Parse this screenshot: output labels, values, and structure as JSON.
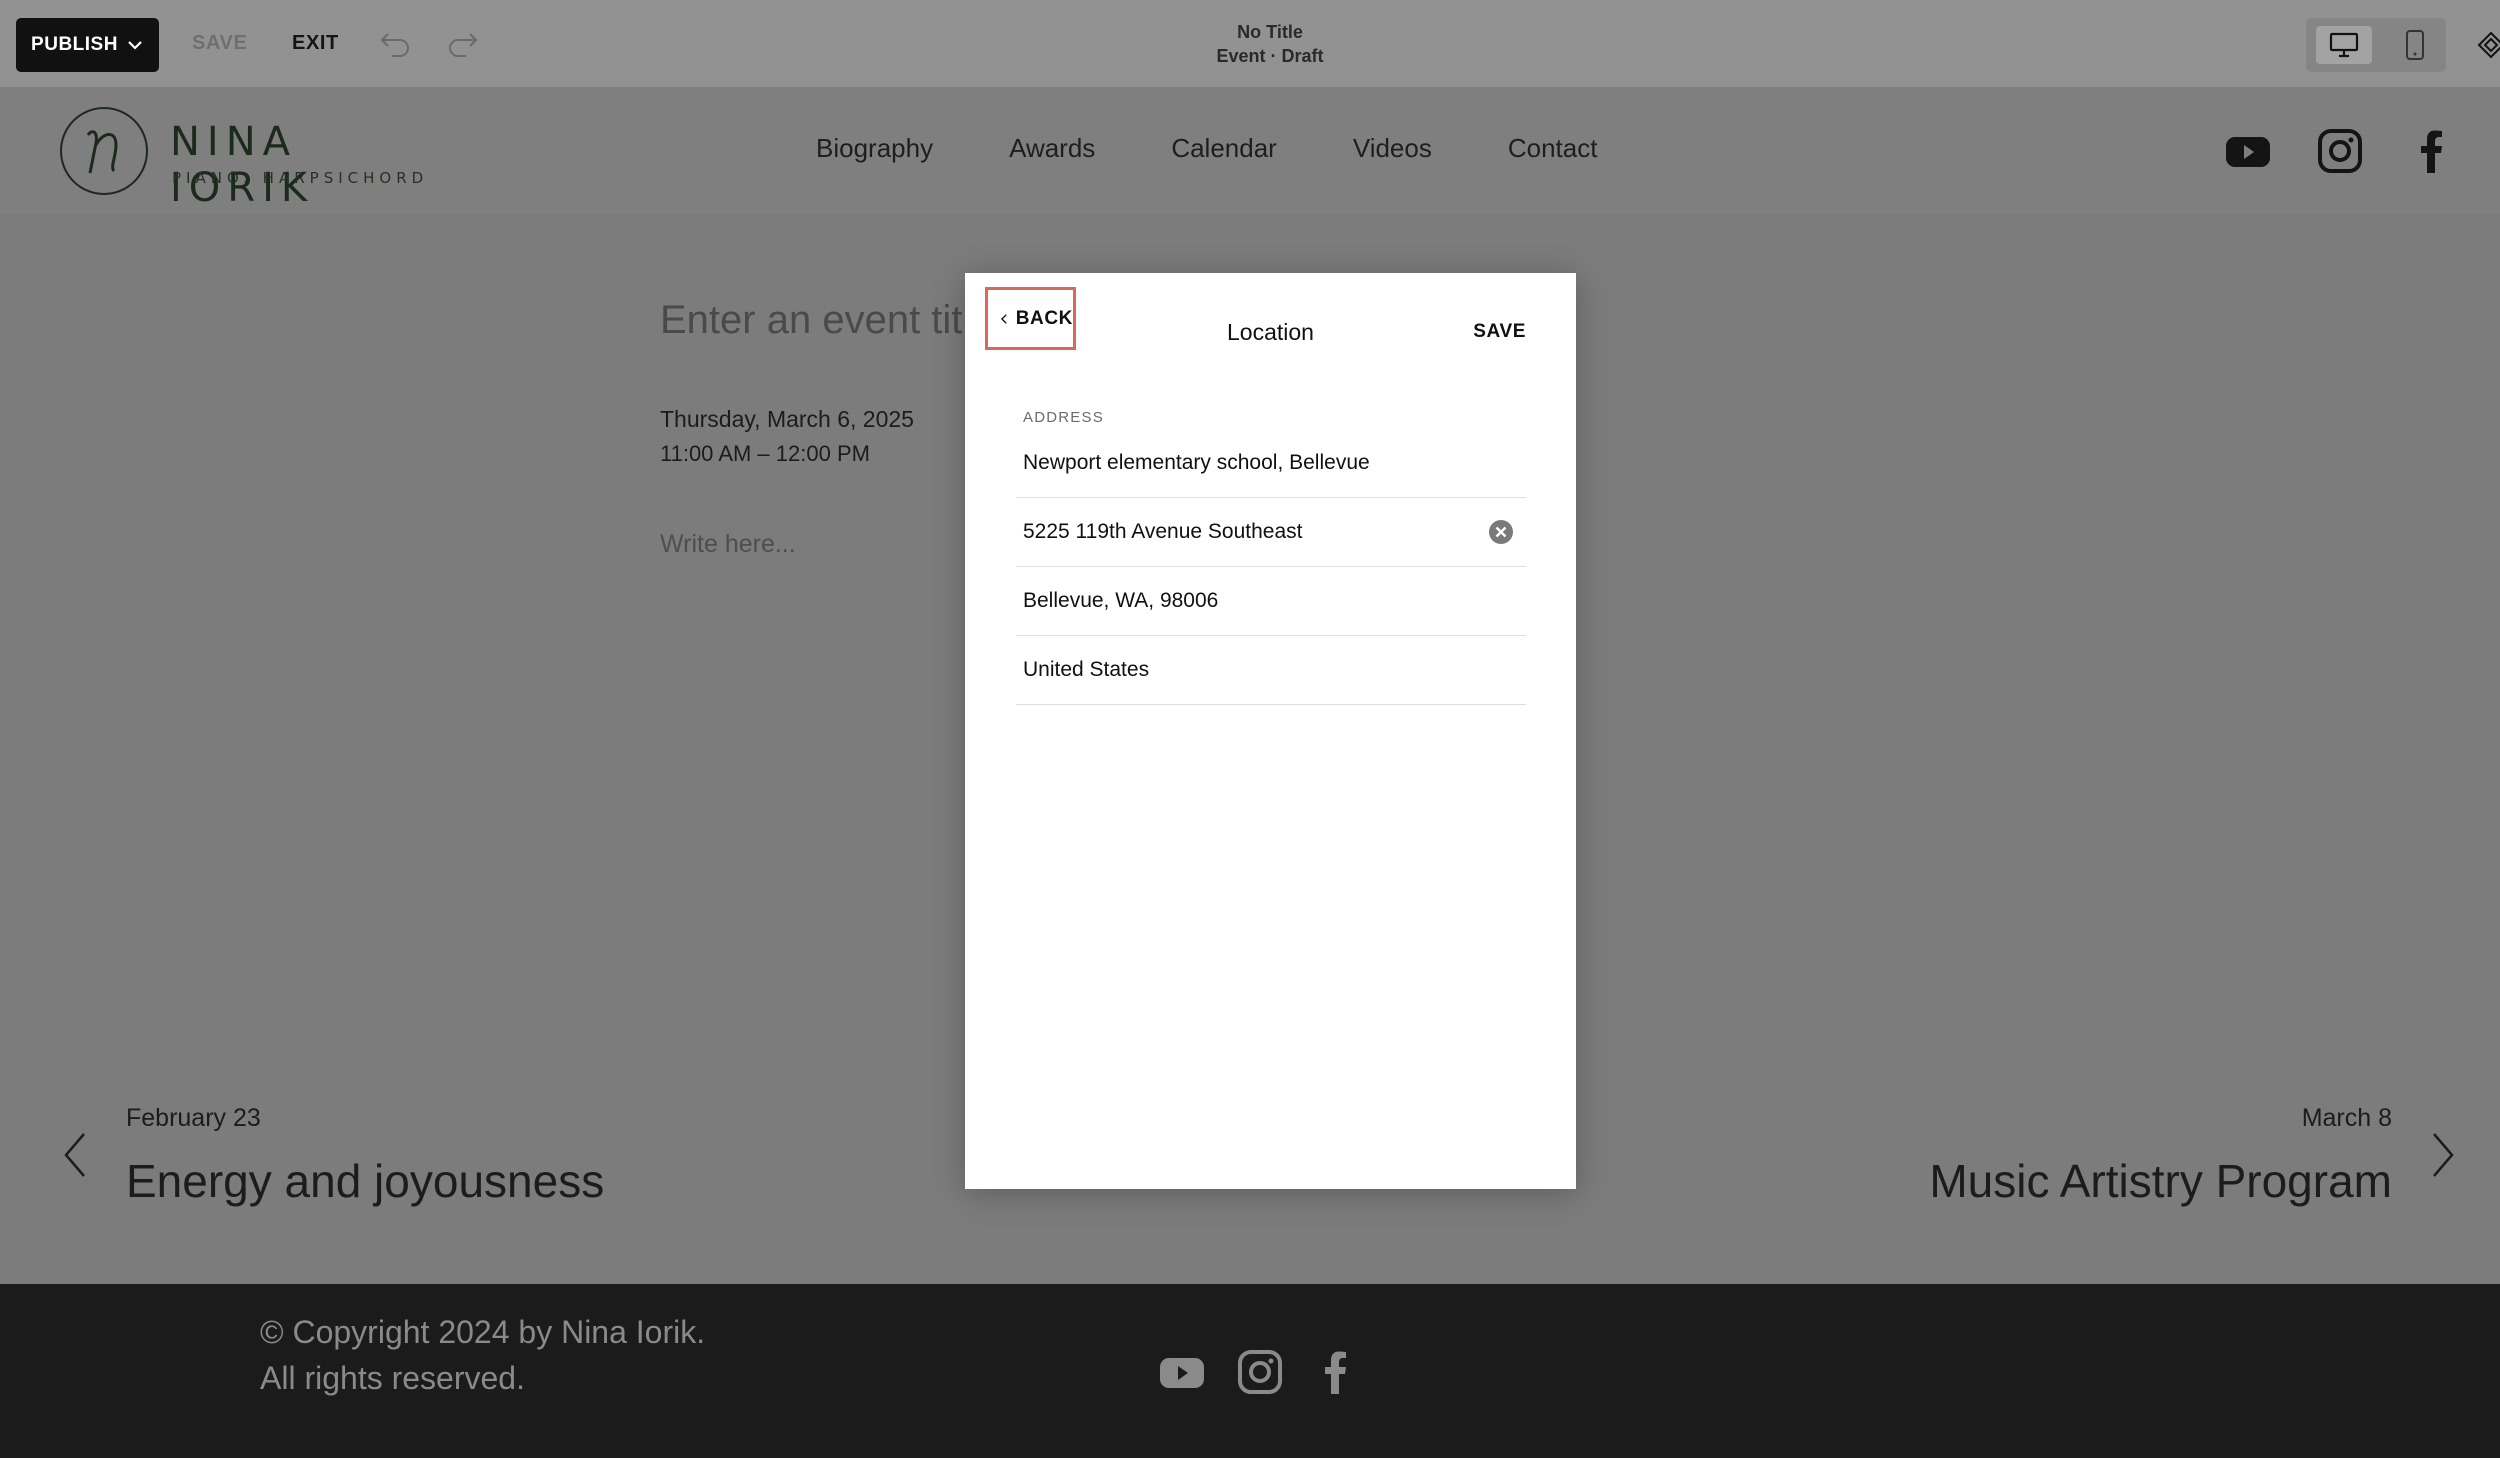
{
  "toolbar": {
    "publish_label": "PUBLISH",
    "save_label": "SAVE",
    "exit_label": "EXIT",
    "doc_title": "No Title",
    "doc_status": "Event · Draft",
    "icons": [
      "chevron-down-icon",
      "undo-icon",
      "redo-icon",
      "desktop-icon",
      "mobile-icon"
    ]
  },
  "site": {
    "logo_name": "NINA IORIK",
    "logo_subtitle": "PIANO. HARPSICHORD",
    "nav": [
      "Biography",
      "Awards",
      "Calendar",
      "Videos",
      "Contact"
    ],
    "social": [
      "youtube-icon",
      "instagram-icon",
      "facebook-icon"
    ]
  },
  "event": {
    "title_placeholder": "Enter an event title",
    "date": "Thursday, March 6, 2025",
    "time": "11:00 AM – 12:00 PM",
    "body_placeholder": "Write here..."
  },
  "pager": {
    "prev_date": "February 23",
    "prev_title": "Energy and joyousness",
    "next_date": "March 8",
    "next_title": "Music Artistry Program"
  },
  "footer": {
    "copyright_line1": "© Copyright 2024 by Nina Iorik.",
    "copyright_line2": "All rights reserved."
  },
  "modal": {
    "back_label": "BACK",
    "title": "Location",
    "save_label": "SAVE",
    "address_label": "ADDRESS",
    "fields": [
      "Newport elementary school, Bellevue",
      "5225 119th Avenue Southeast",
      "Bellevue, WA, 98006",
      "United States"
    ]
  },
  "colors": {
    "highlight": "#d9695e",
    "footer_bg": "#1b1b1b",
    "logo_green": "#1c2a1c"
  }
}
